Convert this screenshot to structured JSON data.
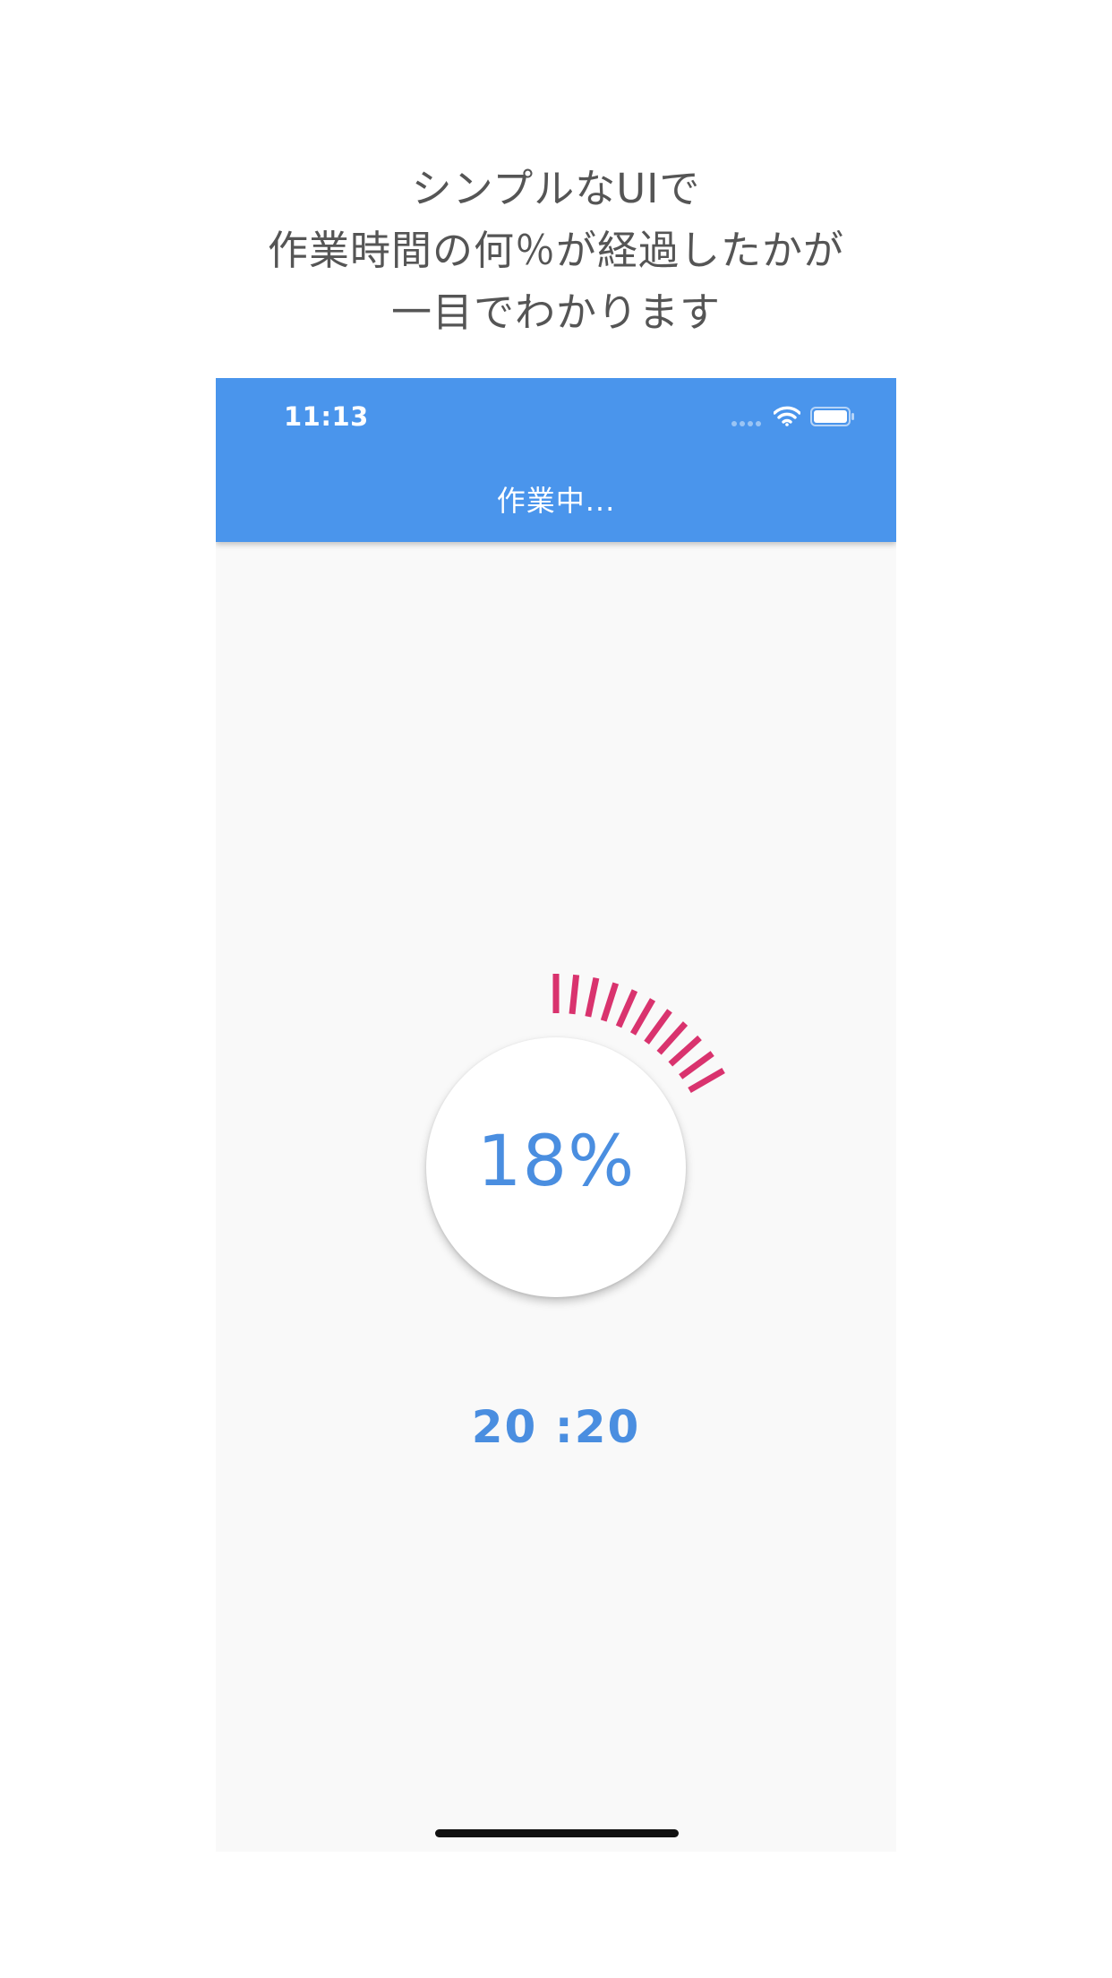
{
  "caption": {
    "lines": [
      "シンプルなUIで",
      "作業時間の何％が経過したかが",
      "一目でわかります"
    ]
  },
  "status_bar": {
    "time": "11:13",
    "icons": [
      "signal-icon",
      "wifi-icon",
      "battery-icon"
    ]
  },
  "app_bar": {
    "title": "作業中..."
  },
  "progress": {
    "percent_label": "18%",
    "elapsed_fraction": 0.18,
    "tick_color": "#d9336e"
  },
  "timer": {
    "value": "20 :20"
  },
  "colors": {
    "app_bar": "#4a95ec",
    "accent_text": "#4a8ee0",
    "progress_ticks": "#d9336e",
    "background": "#f9f9f9"
  }
}
